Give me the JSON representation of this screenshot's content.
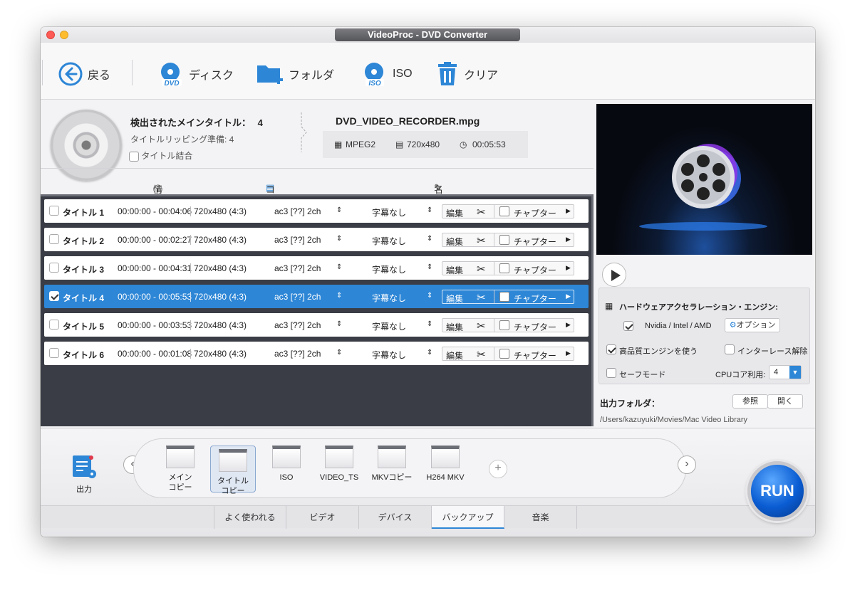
{
  "window": {
    "title": "VideoProc - DVD Converter"
  },
  "toolbar": {
    "back_label": "戻る",
    "disc_label": "ディスク",
    "folder_label": "フォルダ",
    "iso_label": "ISO",
    "clear_label": "クリア"
  },
  "info": {
    "main_title_label": "検出されたメインタイトル：",
    "main_title_value": "4",
    "ripping_label": "タイトルリッピング準備: 4",
    "merge_label": "タイトル結合",
    "filename": "DVD_VIDEO_RECORDER.mpg",
    "codec": "MPEG2",
    "resolution": "720x480",
    "duration": "00:05:53",
    "tab_info": "情報",
    "tab_codec": "コーデック",
    "tab_rename": "名前変更"
  },
  "titles": [
    {
      "name": "タイトル 1",
      "time": "00:00:00 - 00:04:06",
      "res": "720x480 (4:3)",
      "audio": "ac3 [??] 2ch",
      "sub": "字幕なし",
      "edit": "編集",
      "chapter": "チャプター",
      "checked": false
    },
    {
      "name": "タイトル 2",
      "time": "00:00:00 - 00:02:27",
      "res": "720x480 (4:3)",
      "audio": "ac3 [??] 2ch",
      "sub": "字幕なし",
      "edit": "編集",
      "chapter": "チャプター",
      "checked": false
    },
    {
      "name": "タイトル 3",
      "time": "00:00:00 - 00:04:31",
      "res": "720x480 (4:3)",
      "audio": "ac3 [??] 2ch",
      "sub": "字幕なし",
      "edit": "編集",
      "chapter": "チャプター",
      "checked": false
    },
    {
      "name": "タイトル 4",
      "time": "00:00:00 - 00:05:53",
      "res": "720x480 (4:3)",
      "audio": "ac3 [??] 2ch",
      "sub": "字幕なし",
      "edit": "編集",
      "chapter": "チャプター",
      "checked": true
    },
    {
      "name": "タイトル 5",
      "time": "00:00:00 - 00:03:53",
      "res": "720x480 (4:3)",
      "audio": "ac3 [??] 2ch",
      "sub": "字幕なし",
      "edit": "編集",
      "chapter": "チャプター",
      "checked": false
    },
    {
      "name": "タイトル 6",
      "time": "00:00:00 - 00:01:08",
      "res": "720x480 (4:3)",
      "audio": "ac3 [??] 2ch",
      "sub": "字幕なし",
      "edit": "編集",
      "chapter": "チャプター",
      "checked": false
    }
  ],
  "hw": {
    "title": "ハードウェアアクセラレーション・エンジン:",
    "nvidia_label": "Nvidia /  Intel / AMD",
    "option_label": "オプション",
    "hq_label": "高品質エンジンを使う",
    "deinterlace_label": "インターレース解除",
    "safe_label": "セーフモード",
    "cpu_label": "CPUコア利用:",
    "cpu_value": "4"
  },
  "output": {
    "label": "出力フォルダ：",
    "browse_label": "参照",
    "open_label": "開く",
    "path": "/Users/kazuyuki/Movies/Mac Video Library"
  },
  "profiles": {
    "output_label": "出力",
    "items": [
      {
        "label1": "メイン",
        "label2": "コピー"
      },
      {
        "label1": "タイトル",
        "label2": "コピー"
      },
      {
        "label1": "ISO",
        "label2": ""
      },
      {
        "label1": "VIDEO_TS",
        "label2": ""
      },
      {
        "label1": "MKVコピー",
        "label2": ""
      },
      {
        "label1": "H264 MKV",
        "label2": ""
      }
    ]
  },
  "categories": [
    "よく使われる",
    "ビデオ",
    "デバイス",
    "バックアップ",
    "音楽"
  ],
  "run_label": "RUN",
  "colors": {
    "accent": "#2d86d6",
    "list_bg": "#3a3d45"
  }
}
